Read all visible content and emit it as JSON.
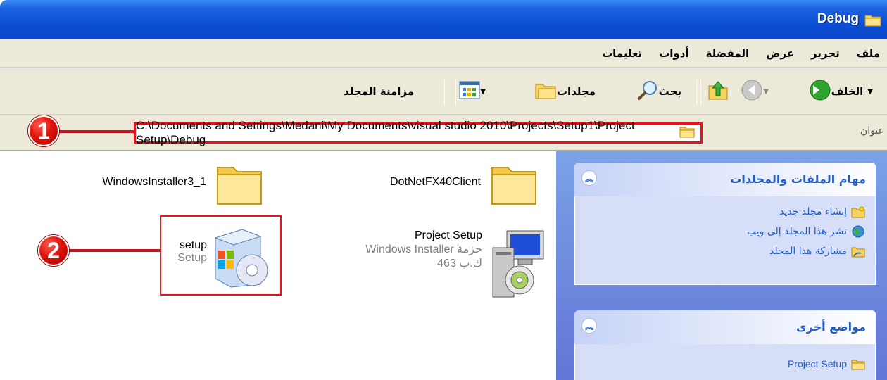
{
  "window": {
    "title": "Debug"
  },
  "menu": [
    "ملف",
    "تحرير",
    "عرض",
    "المفضلة",
    "أدوات",
    "تعليمات"
  ],
  "toolbar": {
    "back_label": "الخلف",
    "search_label": "بحث",
    "folders_label": "مجلدات",
    "sync_label": "مزامنة المجلد"
  },
  "address": {
    "label": "عنوان",
    "path": "C:\\Documents and Settings\\Medani\\My Documents\\visual studio 2010\\Projects\\Setup1\\Project Setup\\Debug"
  },
  "callouts": {
    "one": "1",
    "two": "2"
  },
  "taskpane": {
    "file_tasks": {
      "title": "مهام الملفات والمجلدات",
      "items": [
        "إنشاء مجلد جديد",
        "نشر هذا المجلد إلى ويب",
        "مشاركة هذا المجلد"
      ]
    },
    "other_places": {
      "title": "مواضع أخرى",
      "items": [
        "Project Setup"
      ]
    }
  },
  "files": {
    "dotnet": {
      "name": "DotNetFX40Client"
    },
    "wininstaller": {
      "name": "WindowsInstaller3_1"
    },
    "project_setup": {
      "name": "Project Setup",
      "type": "Windows Installer حزمة",
      "size": "ك.ب 463"
    },
    "setup": {
      "name": "setup",
      "type": "Setup"
    }
  },
  "colors": {
    "title_bar": "#0a47c4",
    "highlight": "#e8141c",
    "task_blue": "#215dc6"
  }
}
